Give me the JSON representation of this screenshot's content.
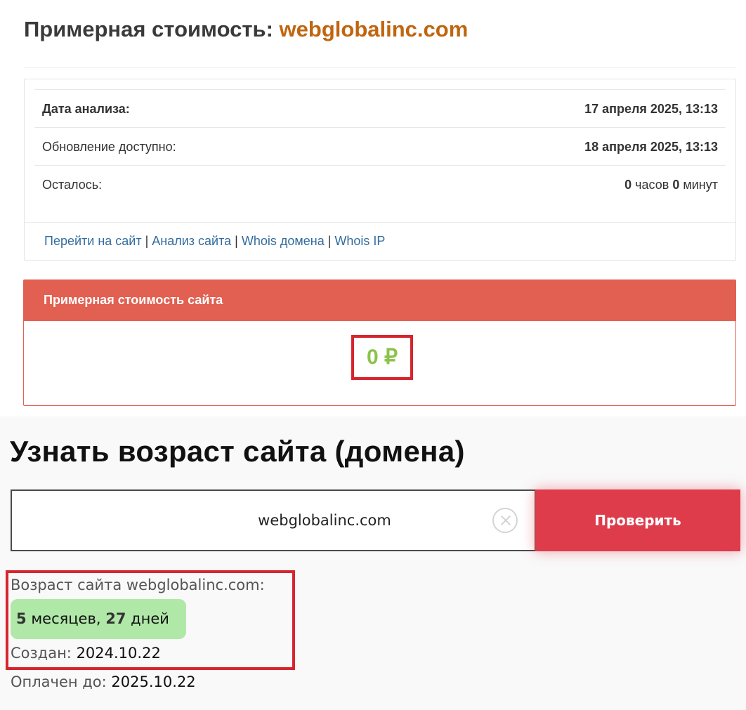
{
  "header": {
    "title_prefix": "Примерная стоимость:",
    "title_domain": "webglobalinc.com",
    "domain_color": "#c0650f"
  },
  "info": {
    "rows": [
      {
        "label": "Дата анализа:",
        "value": "17 апреля 2025, 13:13"
      },
      {
        "label": "Обновление доступно:",
        "value": "18 апреля 2025, 13:13"
      },
      {
        "label": "Осталось:",
        "hours": "0",
        "hours_unit": "часов",
        "minutes": "0",
        "minutes_unit": "минут"
      }
    ],
    "links": [
      "Перейти на сайт",
      "Анализ сайта",
      "Whois домена",
      "Whois IP"
    ],
    "link_separator": "|"
  },
  "price": {
    "header": "Примерная стоимость сайта",
    "value": "0 ₽",
    "header_color": "#e26051",
    "value_color": "#8bc34a"
  },
  "age_checker": {
    "title": "Узнать возраст сайта (домена)",
    "input_value": "webglobalinc.com",
    "button_label": "Проверить",
    "button_color": "#de3b4b",
    "result_label": "Возраст сайта webglobalinc.com:",
    "age_months": "5",
    "months_word": "месяцев,",
    "age_days": "27",
    "days_word": "дней",
    "created_label": "Создан:",
    "created_value": "2024.10.22",
    "paid_label": "Оплачен до:",
    "paid_value": "2025.10.22",
    "badge_color": "#b0e8a8"
  }
}
